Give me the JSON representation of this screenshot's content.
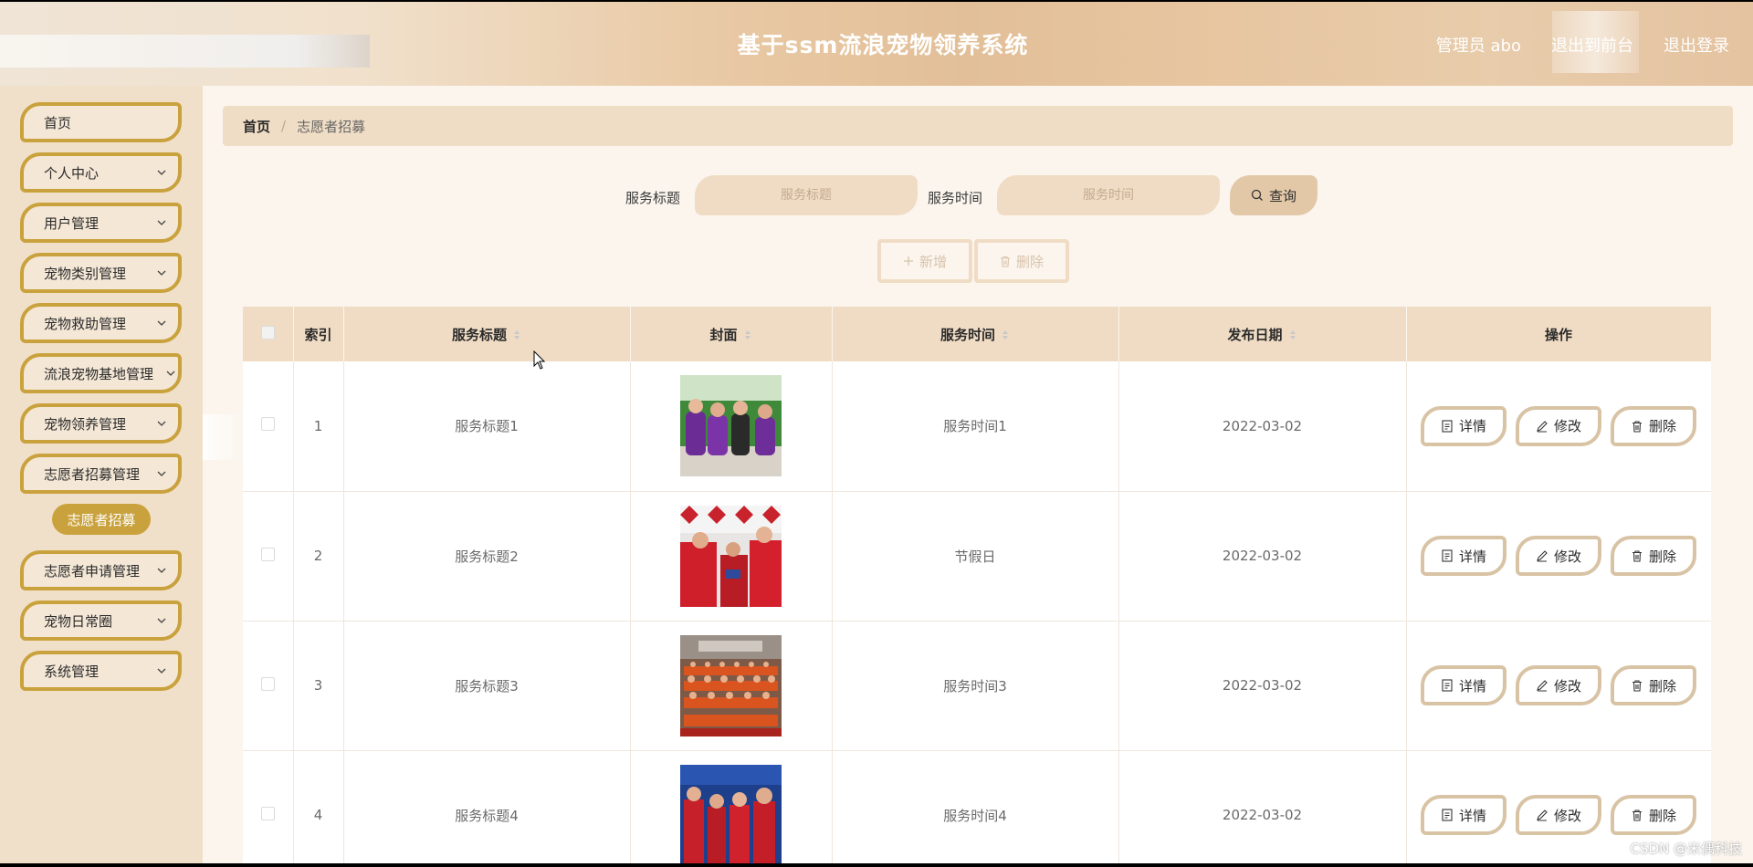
{
  "header": {
    "title": "基于ssm流浪宠物领养系统",
    "admin": "管理员 abo",
    "back_front": "退出到前台",
    "logout": "退出登录"
  },
  "sidebar": {
    "items": [
      {
        "label": "首页",
        "has_chevron": false
      },
      {
        "label": "个人中心",
        "has_chevron": true
      },
      {
        "label": "用户管理",
        "has_chevron": true
      },
      {
        "label": "宠物类别管理",
        "has_chevron": true
      },
      {
        "label": "宠物救助管理",
        "has_chevron": true
      },
      {
        "label": "流浪宠物基地管理",
        "has_chevron": true
      },
      {
        "label": "宠物领养管理",
        "has_chevron": true
      },
      {
        "label": "志愿者招募管理",
        "has_chevron": true
      },
      {
        "label": "志愿者申请管理",
        "has_chevron": true
      },
      {
        "label": "宠物日常圈",
        "has_chevron": true
      },
      {
        "label": "系统管理",
        "has_chevron": true
      }
    ],
    "active_submenu": "志愿者招募"
  },
  "breadcrumb": {
    "home": "首页",
    "separator": "/",
    "current": "志愿者招募"
  },
  "search": {
    "title_label": "服务标题",
    "title_placeholder": "服务标题",
    "time_label": "服务时间",
    "time_placeholder": "服务时间",
    "query_button": "查询"
  },
  "actions": {
    "add": "新增",
    "delete": "删除"
  },
  "table": {
    "columns": [
      "索引",
      "服务标题",
      "封面",
      "服务时间",
      "发布日期",
      "操作"
    ],
    "rows": [
      {
        "index": "1",
        "title": "服务标题1",
        "time": "服务时间1",
        "date": "2022-03-02"
      },
      {
        "index": "2",
        "title": "服务标题2",
        "time": "节假日",
        "date": "2022-03-02"
      },
      {
        "index": "3",
        "title": "服务标题3",
        "time": "服务时间3",
        "date": "2022-03-02"
      },
      {
        "index": "4",
        "title": "服务标题4",
        "time": "服务时间4",
        "date": "2022-03-02"
      }
    ],
    "row_actions": {
      "detail": "详情",
      "edit": "修改",
      "delete": "删除"
    }
  },
  "watermark": "CSDN @米偶科技",
  "colors": {
    "accent_gold": "#c9a23d",
    "header_tan": "#e2bf98",
    "panel_beige": "#f0dcc4"
  }
}
